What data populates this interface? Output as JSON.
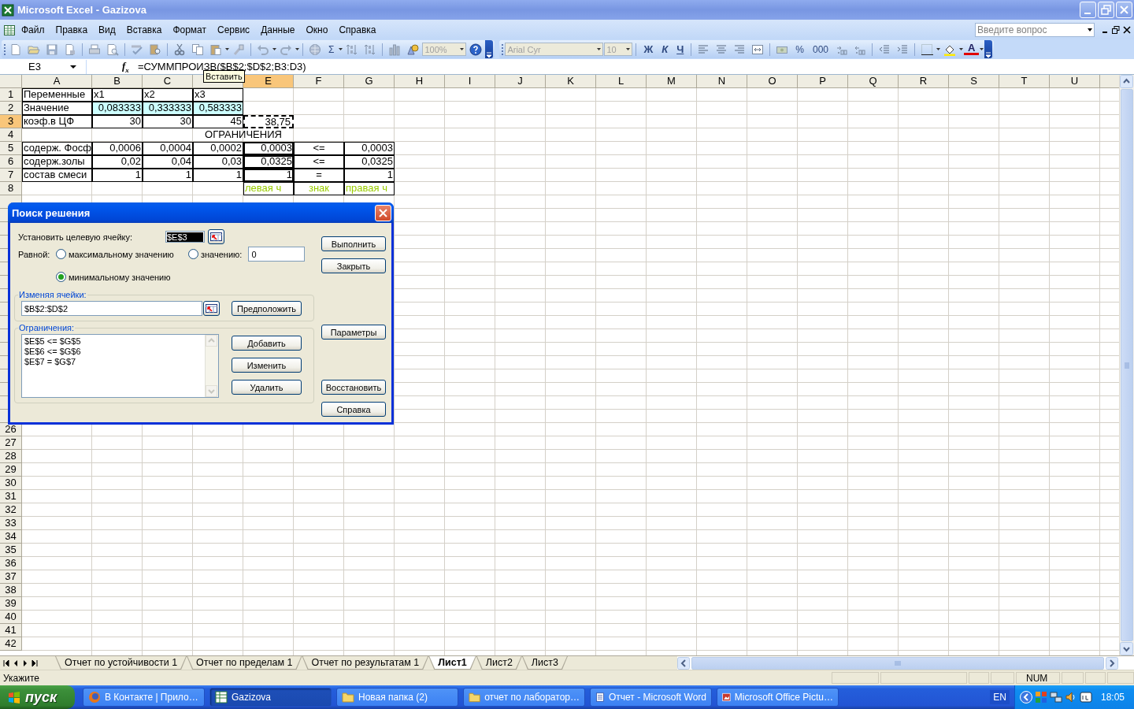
{
  "window": {
    "title": "Microsoft Excel - Gazizova"
  },
  "menu": [
    "Файл",
    "Правка",
    "Вид",
    "Вставка",
    "Формат",
    "Сервис",
    "Данные",
    "Окно",
    "Справка"
  ],
  "help_box": {
    "placeholder": "Введите вопрос"
  },
  "standard_toolbar": {
    "autosum": "Σ",
    "zoom": {
      "value": "100%",
      "disabled": true
    }
  },
  "formatting_toolbar": {
    "font": {
      "value": "Arial Cyr",
      "disabled": true
    },
    "size": {
      "value": "10",
      "disabled": true
    },
    "bold": "Ж",
    "italic": "К",
    "underline": "Ч",
    "percent": "%",
    "thousands": "000",
    "font_color": "A"
  },
  "formula_bar": {
    "name_box": "E3",
    "function_button": "f$_{x}$",
    "formula": "=СУММПРОИЗВ($B$2;$D$2;B3:D3)"
  },
  "tooltip": "Вставить",
  "sheet": {
    "columns": [
      {
        "label": "A",
        "selected": false
      },
      {
        "label": "B",
        "selected": false
      },
      {
        "label": "C",
        "selected": false
      },
      {
        "selected": false
      },
      {
        "label": "E",
        "selected": true
      },
      {
        "label": "F",
        "selected": false
      },
      {
        "label": "G",
        "selected": false
      },
      {
        "label": "H",
        "selected": false
      },
      {
        "label": "I",
        "selected": false
      },
      {
        "label": "J",
        "selected": false
      },
      {
        "label": "K",
        "selected": false
      },
      {
        "label": "L",
        "selected": false
      },
      {
        "label": "M",
        "selected": false
      },
      {
        "label": "N",
        "selected": false
      },
      {
        "label": "O",
        "selected": false
      },
      {
        "label": "P",
        "selected": false
      },
      {
        "label": "Q",
        "selected": false
      },
      {
        "label": "R",
        "selected": false
      },
      {
        "label": "S",
        "selected": false
      },
      {
        "label": "T",
        "selected": false
      },
      {
        "label": "U",
        "selected": false
      }
    ],
    "rows_above_dialog": [
      {
        "header": "1",
        "selected": false,
        "cells": [
          {
            "text": "Переменные",
            "kind": "label"
          },
          {
            "text": "x1",
            "kind": "label"
          },
          {
            "text": "x2",
            "kind": "label"
          },
          {
            "text": "x3",
            "kind": "label"
          }
        ]
      },
      {
        "header": "2",
        "selected": false,
        "cells": [
          {
            "text": "Значение",
            "kind": "label"
          },
          {
            "text": "0,083333",
            "kind": "number",
            "highlighted": true
          },
          {
            "text": "0,333333",
            "kind": "number",
            "highlighted": true
          },
          {
            "text": "0,583333",
            "kind": "number",
            "highlighted": true
          }
        ]
      },
      {
        "header": "3",
        "selected": true,
        "cells": [
          {
            "text": "коэф.в ЦФ",
            "kind": "label"
          },
          {
            "text": "30",
            "kind": "number"
          },
          {
            "text": "30",
            "kind": "number"
          },
          {
            "text": "45",
            "kind": "number"
          },
          {
            "text": "38,75",
            "kind": "number",
            "marquee": true
          }
        ]
      },
      {
        "header": "4",
        "selected": false,
        "cells": [
          null,
          {
            "text": "ОГРАНИЧЕНИЯ",
            "kind": "title"
          }
        ]
      },
      {
        "header": "5",
        "selected": false,
        "cells": [
          {
            "text": "содерж. Фосф",
            "kind": "label"
          },
          {
            "text": "0,0006",
            "kind": "number"
          },
          {
            "text": "0,0004",
            "kind": "number"
          },
          {
            "text": "0,0002",
            "kind": "number"
          },
          {
            "text": "0,0003",
            "kind": "number",
            "outlined": true
          },
          {
            "text": "<=",
            "kind": "sign"
          },
          {
            "text": "0,0003",
            "kind": "number"
          }
        ]
      },
      {
        "header": "6",
        "selected": false,
        "cells": [
          {
            "text": "содерж.золы",
            "kind": "label"
          },
          {
            "text": "0,02",
            "kind": "number"
          },
          {
            "text": "0,04",
            "kind": "number"
          },
          {
            "text": "0,03",
            "kind": "number"
          },
          {
            "text": "0,0325",
            "kind": "number",
            "outlined": true
          },
          {
            "text": "<=",
            "kind": "sign"
          },
          {
            "text": "0,0325",
            "kind": "number"
          }
        ]
      },
      {
        "header": "7",
        "selected": false,
        "cells": [
          {
            "text": "состав смеси",
            "kind": "label"
          },
          {
            "text": "1",
            "kind": "number"
          },
          {
            "text": "1",
            "kind": "number"
          },
          {
            "text": "1",
            "kind": "number"
          },
          {
            "text": "1",
            "kind": "number",
            "outlined": true
          },
          {
            "text": "=",
            "kind": "sign"
          },
          {
            "text": "1",
            "kind": "number"
          }
        ]
      },
      {
        "header": "8",
        "selected": false,
        "cells": [
          null,
          null,
          null,
          null,
          {
            "text": "левая ч",
            "kind": "caption"
          },
          {
            "text": "знак",
            "kind": "note"
          },
          {
            "text": "правая ч",
            "kind": "caption"
          }
        ]
      }
    ],
    "rows_below_dialog": [
      {
        "header": "26",
        "selected": false
      },
      {
        "header": "27",
        "selected": false
      },
      {
        "header": "28",
        "selected": false
      },
      {
        "header": "29",
        "selected": false
      },
      {
        "header": "30",
        "selected": false
      },
      {
        "header": "31",
        "selected": false
      },
      {
        "header": "32",
        "selected": false
      },
      {
        "header": "33",
        "selected": false
      },
      {
        "header": "34",
        "selected": false
      },
      {
        "header": "35",
        "selected": false
      },
      {
        "header": "36",
        "selected": false
      },
      {
        "header": "37",
        "selected": false
      },
      {
        "header": "38",
        "selected": false
      },
      {
        "header": "39",
        "selected": false
      },
      {
        "header": "40",
        "selected": false
      },
      {
        "header": "41",
        "selected": false
      },
      {
        "header": "42",
        "selected": false
      }
    ]
  },
  "dialog": {
    "title": "Поиск решения",
    "target_label": "Установить целевую ячейку:",
    "target_cell": "$E$3",
    "equal_label": "Равной:",
    "options": [
      {
        "label": "максимальному значению",
        "selected": false
      },
      {
        "label": "значению:",
        "selected": false
      },
      {
        "label": "минимальному значению",
        "selected": true
      }
    ],
    "value_field": "0",
    "changing_label": "Изменяя ячейки:",
    "changing_cells": "$B$2:$D$2",
    "guess_button": "Предположить",
    "constraints_label": "Ограничения:",
    "constraints": [
      "$E$5 <= $G$5",
      "$E$6 <= $G$6",
      "$E$7 = $G$7"
    ],
    "constraint_buttons": [
      "Добавить",
      "Изменить",
      "Удалить"
    ],
    "buttons": [
      "Выполнить",
      "Закрыть",
      "Параметры",
      "Восстановить",
      "Справка"
    ]
  },
  "sheet_tabs": [
    {
      "label": "Отчет по устойчивости 1",
      "selected": false
    },
    {
      "label": "Отчет по пределам 1",
      "selected": false
    },
    {
      "label": "Отчет по результатам 1",
      "selected": false
    },
    {
      "label": "Лист1",
      "selected": true
    },
    {
      "label": "Лист2",
      "selected": false
    },
    {
      "label": "Лист3",
      "selected": false
    }
  ],
  "status_bar": {
    "mode": "Укажите",
    "indicator": "NUM"
  },
  "taskbar": {
    "start": "пуск",
    "tasks": [
      {
        "label": "В Контакте | Прило…",
        "kind": "browser",
        "selected": false
      },
      {
        "label": "Gazizova",
        "kind": "spreadsheet",
        "selected": true
      },
      {
        "label": "Новая папка (2)",
        "kind": "folder",
        "selected": false
      },
      {
        "label": "отчет по лаборатор…",
        "kind": "folder",
        "selected": false
      },
      {
        "label": "Отчет - Microsoft Word",
        "kind": "document",
        "selected": false
      },
      {
        "label": "Microsoft Office Pictu…",
        "kind": "image",
        "selected": false
      }
    ],
    "language": "EN",
    "clock": "18:05"
  }
}
